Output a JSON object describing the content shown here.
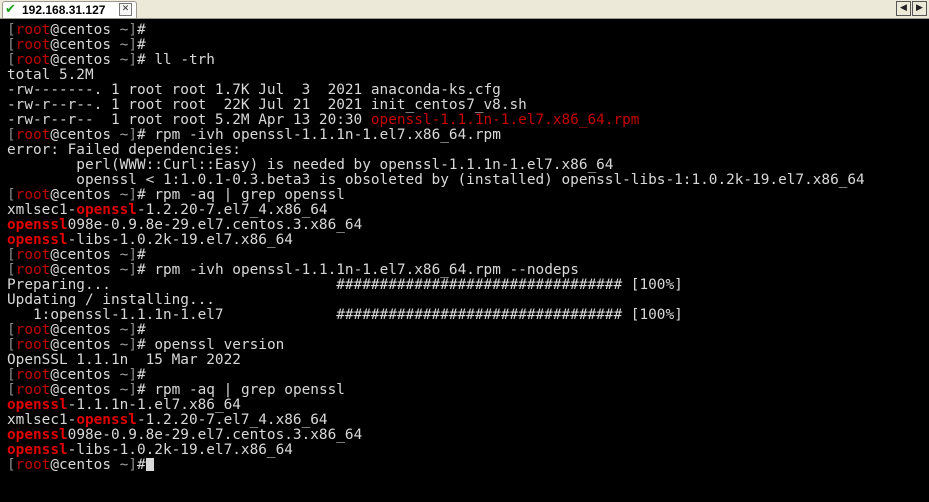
{
  "tab": {
    "title": "192.168.31.127"
  },
  "prompt": {
    "user": "root",
    "host": "centos",
    "path": "~"
  },
  "commands": {
    "ll": "ll -trh",
    "install": "rpm -ivh openssl-1.1.1n-1.el7.x86_64.rpm",
    "query": "rpm -aq | grep openssl",
    "install_nodeps": "rpm -ivh openssl-1.1.1n-1.el7.x86_64.rpm --nodeps",
    "version": "openssl version"
  },
  "ls": {
    "total": "total 5.2M",
    "rows": [
      {
        "meta": "-rw-------. 1 root root 1.7K Jul  3  2021 ",
        "name": "anaconda-ks.cfg"
      },
      {
        "meta": "-rw-r--r--. 1 root root  22K Jul 21  2021 ",
        "name": "init_centos7_v8.sh"
      },
      {
        "meta": "-rw-r--r--  1 root root 5.2M Apr 13 20:30 ",
        "name": "openssl-1.1.1n-1.el7.x86_64.rpm"
      }
    ]
  },
  "errors": {
    "header": "error: Failed dependencies:",
    "dep1": "        perl(WWW::Curl::Easy) is needed by openssl-1.1.1n-1.el7.x86_64",
    "dep2": "        openssl < 1:1.0.1-0.3.beta3 is obsoleted by (installed) openssl-libs-1:1.0.2k-19.el7.x86_64"
  },
  "grep_keyword": "openssl",
  "query1": {
    "r1_pre": "xmlsec1-",
    "r1_post": "-1.2.20-7.el7_4.x86_64",
    "r2_post": "098e-0.9.8e-29.el7.centos.3.x86_64",
    "r3_post": "-libs-1.0.2k-19.el7.x86_64"
  },
  "install": {
    "preparing": "Preparing...                          ################################# [100%]",
    "updating": "Updating / installing...",
    "progress": "   1:openssl-1.1.1n-1.el7             ################################# [100%]"
  },
  "version_output": "OpenSSL 1.1.1n  15 Mar 2022",
  "query2": {
    "r1_post": "-1.1.1n-1.el7.x86_64",
    "r2_pre": "xmlsec1-",
    "r2_post": "-1.2.20-7.el7_4.x86_64",
    "r3_post": "098e-0.9.8e-29.el7.centos.3.x86_64",
    "r4_post": "-libs-1.0.2k-19.el7.x86_64"
  },
  "colors": {
    "background": "#000000",
    "text": "#d8d8d8",
    "user": "#c00000",
    "highlight": "#e00000"
  }
}
